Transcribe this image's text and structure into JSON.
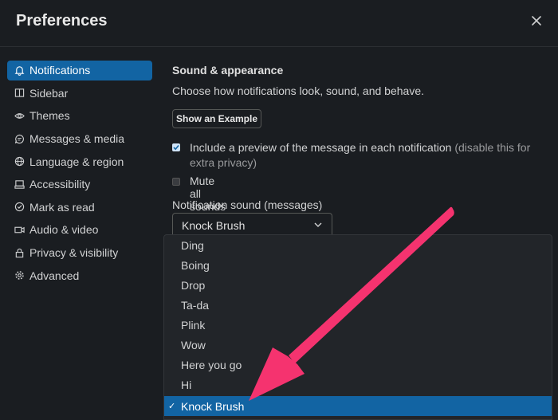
{
  "window": {
    "title": "Preferences"
  },
  "sidebar": {
    "items": [
      {
        "label": "Notifications",
        "icon": "bell-icon",
        "active": true
      },
      {
        "label": "Sidebar",
        "icon": "sidebar-icon"
      },
      {
        "label": "Themes",
        "icon": "eye-icon"
      },
      {
        "label": "Messages & media",
        "icon": "message-icon"
      },
      {
        "label": "Language & region",
        "icon": "globe-icon"
      },
      {
        "label": "Accessibility",
        "icon": "keyboard-icon"
      },
      {
        "label": "Mark as read",
        "icon": "check-circle-icon"
      },
      {
        "label": "Audio & video",
        "icon": "video-icon"
      },
      {
        "label": "Privacy & visibility",
        "icon": "lock-icon"
      },
      {
        "label": "Advanced",
        "icon": "gear-icon"
      }
    ]
  },
  "main": {
    "section_title": "Sound & appearance",
    "section_desc": "Choose how notifications look, sound, and behave.",
    "example_button": "Show an Example",
    "preview_checkbox": {
      "checked": true,
      "label": "Include a preview of the message in each notification",
      "note": "(disable this for extra privacy)"
    },
    "mute_checkbox": {
      "checked": false,
      "label": "Mute all sounds from Slack"
    },
    "sound_label": "Notification sound (messages)",
    "sound_select": {
      "value": "Knock Brush"
    },
    "sound_options": [
      "Ding",
      "Boing",
      "Drop",
      "Ta-da",
      "Plink",
      "Wow",
      "Here you go",
      "Hi",
      "Knock Brush"
    ],
    "selected_option": "Knock Brush",
    "check_glyph": "✓"
  },
  "colors": {
    "accent": "#1264a3",
    "annotation_arrow": "#f5336f",
    "background": "#1a1d21"
  }
}
